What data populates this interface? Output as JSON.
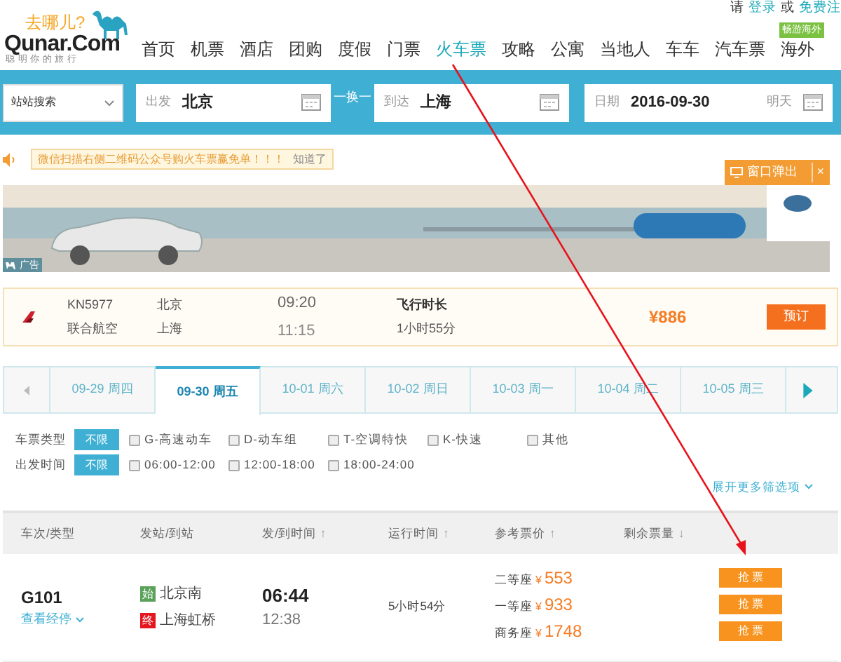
{
  "header": {
    "logo": {
      "slogan": "去哪儿?",
      "brand": "Qunar.Com",
      "tagline": "聪 明 你 的 旅 行"
    },
    "user_links": [
      {
        "text": "请",
        "kind": "text"
      },
      {
        "text": "登录",
        "kind": "link"
      },
      {
        "text": "或",
        "kind": "text"
      },
      {
        "text": "免费注",
        "kind": "link"
      }
    ],
    "nav": [
      {
        "label": "首页",
        "selected": false
      },
      {
        "label": "机票",
        "selected": false
      },
      {
        "label": "酒店",
        "selected": false
      },
      {
        "label": "团购",
        "selected": false
      },
      {
        "label": "度假",
        "selected": false
      },
      {
        "label": "门票",
        "selected": false
      },
      {
        "label": "火车票",
        "selected": true
      },
      {
        "label": "攻略",
        "selected": false
      },
      {
        "label": "公寓",
        "selected": false
      },
      {
        "label": "当地人",
        "selected": false
      },
      {
        "label": "车车",
        "selected": false
      },
      {
        "label": "汽车票",
        "selected": false
      },
      {
        "label": "海外",
        "selected": false,
        "badge": "畅游海外"
      }
    ]
  },
  "search": {
    "mode": "站站搜索",
    "from": {
      "label": "出发",
      "value": "北京"
    },
    "swap": "一换一",
    "to": {
      "label": "到达",
      "value": "上海"
    },
    "date": {
      "label": "日期",
      "value": "2016-09-30",
      "hint": "明天"
    }
  },
  "notice": {
    "text": "微信扫描右侧二维码公众号购火车票赢免单！！！",
    "dismiss": "知道了"
  },
  "popup_button": {
    "label": "窗口弹出",
    "close": "×"
  },
  "ad": {
    "kind": "picture",
    "tag": "广告"
  },
  "flight": {
    "code": "KN5977",
    "airline": "联合航空",
    "from": "北京",
    "to": "上海",
    "depart": "09:20",
    "arrive": "11:15",
    "duration_label": "飞行时长",
    "duration": "1小时55分",
    "price": "¥886",
    "button": "预订"
  },
  "date_tabs": [
    {
      "label": "09-29 周四",
      "selected": false
    },
    {
      "label": "09-30 周五",
      "selected": true
    },
    {
      "label": "10-01 周六",
      "selected": false
    },
    {
      "label": "10-02 周日",
      "selected": false
    },
    {
      "label": "10-03 周一",
      "selected": false
    },
    {
      "label": "10-04 周二",
      "selected": false
    },
    {
      "label": "10-05 周三",
      "selected": false
    }
  ],
  "filters": [
    {
      "label": "车票类型",
      "all": "不限",
      "all_selected": true,
      "options": [
        {
          "label": "G-高速动车",
          "checked": false
        },
        {
          "label": "D-动车组",
          "checked": false
        },
        {
          "label": "T-空调特快",
          "checked": false
        },
        {
          "label": "K-快速",
          "checked": false
        },
        {
          "label": "其他",
          "checked": false
        }
      ]
    },
    {
      "label": "出发时间",
      "all": "不限",
      "all_selected": true,
      "options": [
        {
          "label": "06:00-12:00",
          "checked": false
        },
        {
          "label": "12:00-18:00",
          "checked": false
        },
        {
          "label": "18:00-24:00",
          "checked": false
        }
      ]
    }
  ],
  "more_filters": "展开更多筛选项",
  "table": {
    "columns": [
      {
        "label": "车次/类型"
      },
      {
        "label": "发站/到站"
      },
      {
        "label": "发/到时间",
        "sort": "↑"
      },
      {
        "label": "运行时间",
        "sort": "↑"
      },
      {
        "label": "参考票价",
        "sort": "↑"
      },
      {
        "label": "剩余票量",
        "sort": "↓"
      }
    ],
    "rows": [
      {
        "train": "G101",
        "stops_link": "查看经停",
        "from": {
          "tag": "始",
          "name": "北京南"
        },
        "to": {
          "tag": "终",
          "name": "上海虹桥"
        },
        "depart": "06:44",
        "arrive": "12:38",
        "duration": "5小时54分",
        "prices": [
          {
            "seat": "二等座",
            "currency": "¥",
            "price": "553",
            "button": "抢 票"
          },
          {
            "seat": "一等座",
            "currency": "¥",
            "price": "933",
            "button": "抢 票"
          },
          {
            "seat": "商务座",
            "currency": "¥",
            "price": "1748",
            "button": "抢 票"
          }
        ]
      }
    ]
  }
}
